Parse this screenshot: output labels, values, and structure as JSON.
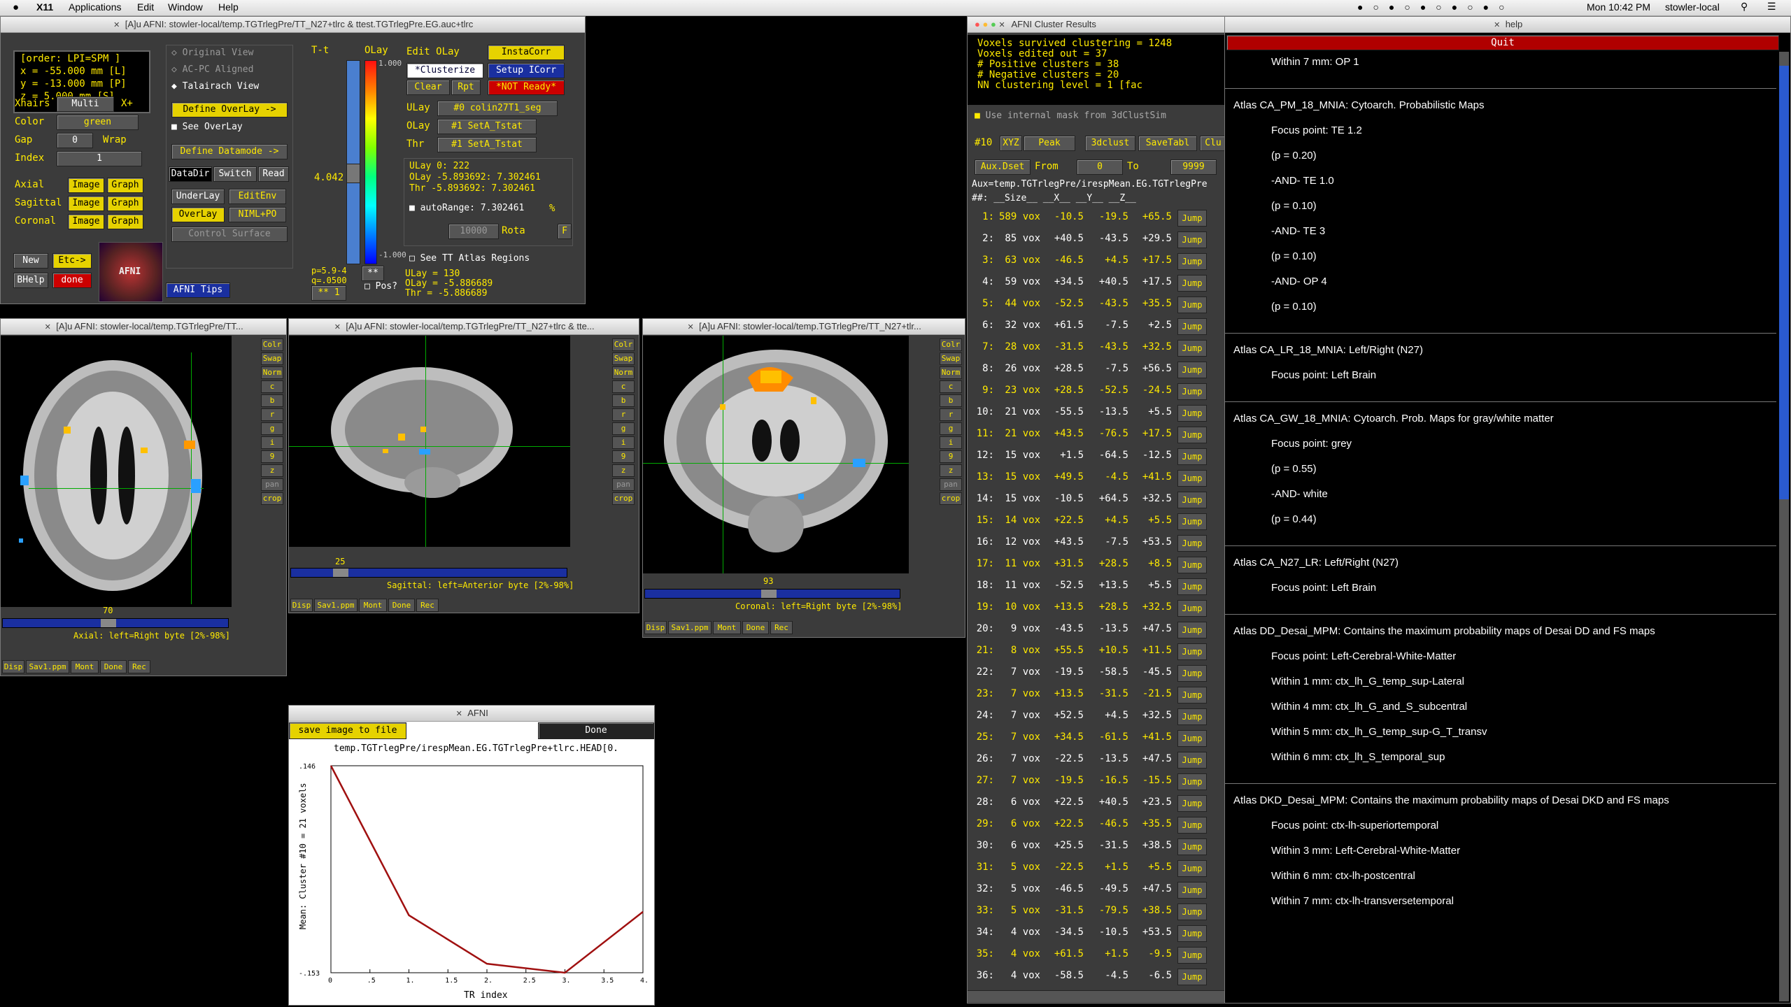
{
  "menubar": {
    "apple": "",
    "items": [
      "X11",
      "Applications",
      "Edit",
      "Window",
      "Help"
    ],
    "clock": "Mon 10:42 PM",
    "user": "stowler-local"
  },
  "main": {
    "title": "[A]u AFNI: stowler-local/temp.TGTrlegPre/TT_N27+tlrc & ttest.TGTrlegPre.EG.auc+tlrc",
    "coords": [
      "[order: LPI=SPM  ]",
      "x = -55.000 mm [L]",
      "y = -13.000 mm [P]",
      "z =   5.000 mm [S]"
    ],
    "xhairs_label": "Xhairs",
    "xhairs_value": "Multi",
    "xplus": "X+",
    "color_label": "Color",
    "color_value": "green",
    "gap_label": "Gap",
    "gap_value": "0",
    "wrap": "Wrap",
    "index_label": "Index",
    "index_value": "1",
    "views": [
      {
        "label": "Axial",
        "image": "Image",
        "graph": "Graph"
      },
      {
        "label": "Sagittal",
        "image": "Image",
        "graph": "Graph"
      },
      {
        "label": "Coronal",
        "image": "Image",
        "graph": "Graph"
      }
    ],
    "new_btn": "New",
    "etc_btn": "Etc->",
    "bhelp_btn": "BHelp",
    "done_btn": "done",
    "logo_text": "AFNI",
    "original_view": "Original View",
    "acpc_view": "AC-PC Aligned",
    "talairach_view": "Talairach View",
    "define_overlay": "Define OverLay ->",
    "see_overlay": "See OverLay",
    "define_datamode": "Define Datamode ->",
    "datadir": "DataDir",
    "switch_btn": "Switch",
    "read_btn": "Read",
    "underlay_btn": "UnderLay",
    "editenv_btn": "EditEnv",
    "overlay_btn": "OverLay",
    "nimlpo_btn": "NIML+PO",
    "control_surface": "Control Surface",
    "afni_tips": "AFNI Tips",
    "tt_label": "T-t",
    "olay_label": "OLay",
    "cbar_top": "1.000",
    "cbar_bottom": "-1.000",
    "cbar_value": "4.042",
    "edit_olay": "Edit OLay",
    "instacorr": "InstaCorr",
    "clusterize": "*Clusterize",
    "setup_icorr": "Setup ICorr",
    "clear_btn": "Clear",
    "rpt_btn": "Rpt",
    "not_ready": "*NOT Ready*",
    "ulay_label": "ULay",
    "ulay_value": "#0 colin27T1_seg",
    "olay_sel_label": "OLay",
    "olay_sel_value": "#1 SetA_Tstat",
    "thr_label": "Thr",
    "thr_value": "#1 SetA_Tstat",
    "ulay_info": "ULay        0:     222",
    "olay_info": "OLay -5.893692: 7.302461",
    "thr_info": "Thr  -5.893692: 7.302461",
    "autorange": "autoRange: 7.302461",
    "pct": "%",
    "num_field": "10000",
    "rota": "Rota",
    "fbtn": "F",
    "p_label": "p=5.9-4",
    "q_label": "q=.0500",
    "stars": "**",
    "pos_label": "Pos?",
    "see_tt": "See TT Atlas Regions",
    "pt_ulay": "ULay = 130",
    "pt_olay": "OLay = -5.886689",
    "pt_thr": "Thr  = -5.886689",
    "bottom_stars": "**",
    "bottom_num": "1"
  },
  "axial": {
    "title": "[A]u AFNI: stowler-local/temp.TGTrlegPre/TT...",
    "slice": "70",
    "caption": "Axial: left=Right byte [2%-98%]",
    "side": [
      "Colr",
      "Swap",
      "Norm",
      "c",
      "b",
      "r",
      "g",
      "i",
      "9",
      "z",
      "pan",
      "crop"
    ],
    "bottom": [
      "Disp",
      "Sav1.ppm",
      "Mont",
      "Done",
      "Rec"
    ]
  },
  "sagittal": {
    "title": "[A]u AFNI: stowler-local/temp.TGTrlegPre/TT_N27+tlrc & tte...",
    "slice": "25",
    "caption": "Sagittal: left=Anterior byte [2%-98%]",
    "side": [
      "Colr",
      "Swap",
      "Norm",
      "c",
      "b",
      "r",
      "g",
      "i",
      "9",
      "z",
      "pan",
      "crop"
    ],
    "bottom": [
      "Disp",
      "Sav1.ppm",
      "Mont",
      "Done",
      "Rec"
    ]
  },
  "coronal": {
    "title": "[A]u AFNI: stowler-local/temp.TGTrlegPre/TT_N27+tlr...",
    "slice": "93",
    "caption": "Coronal: left=Right byte [2%-98%]",
    "side": [
      "Colr",
      "Swap",
      "Norm",
      "c",
      "b",
      "r",
      "g",
      "i",
      "9",
      "z",
      "pan",
      "crop"
    ],
    "bottom": [
      "Disp",
      "Sav1.ppm",
      "Mont",
      "Done",
      "Rec"
    ]
  },
  "plot": {
    "title": "AFNI",
    "save_btn": "save image to file",
    "done_btn": "Done",
    "file_label": "temp.TGTrlegPre/irespMean.EG.TGTrlegPre+tlrc.HEAD[0.",
    "ylabel": "Mean: Cluster #10 = 21 voxels",
    "xlabel": "TR index",
    "ytick_top": ".146",
    "ytick_bottom": "-.153",
    "xticks": [
      "0",
      ".5",
      "1.",
      "1.5",
      "2.",
      "2.5",
      "3.",
      "3.5",
      "4."
    ]
  },
  "chart_data": {
    "type": "line",
    "x": [
      0,
      1,
      2,
      3,
      4
    ],
    "y": [
      0.146,
      -0.07,
      -0.14,
      -0.153,
      -0.065
    ],
    "xlim": [
      0,
      4
    ],
    "ylim": [
      -0.153,
      0.146
    ],
    "xlabel": "TR index",
    "ylabel": "Mean: Cluster #10 = 21 voxels",
    "color": "#a01010"
  },
  "cluster": {
    "title": "AFNI Cluster Results",
    "summary": [
      "Voxels survived clustering =   1248",
      "Voxels edited out          =     37",
      "# Positive clusters        =     38",
      "# Negative clusters        =     20",
      "NN clustering level        =      1 [fac"
    ],
    "use_mask": "Use internal mask from 3dClustSim",
    "num": "#10",
    "xyz": "XYZ",
    "peak": "Peak",
    "clust3d": "3dclust",
    "savetabl": "SaveTabl",
    "clu": "Clu",
    "auxdset": "Aux.Dset",
    "from_label": "From",
    "from_value": "0",
    "to_label": "To",
    "to_value": "9999",
    "auxpath": "Aux=temp.TGTrlegPre/irespMean.EG.TGTrlegPre",
    "header": "##: __Size__  __X__  __Y__  __Z__",
    "jump": "Jump",
    "rows": [
      {
        "n": "1:",
        "size": "589 vox",
        "x": "-10.5",
        "y": "-19.5",
        "z": "+65.5",
        "pos": true
      },
      {
        "n": "2:",
        "size": "85 vox",
        "x": "+40.5",
        "y": "-43.5",
        "z": "+29.5",
        "pos": false
      },
      {
        "n": "3:",
        "size": "63 vox",
        "x": "-46.5",
        "y": "+4.5",
        "z": "+17.5",
        "pos": true
      },
      {
        "n": "4:",
        "size": "59 vox",
        "x": "+34.5",
        "y": "+40.5",
        "z": "+17.5",
        "pos": false
      },
      {
        "n": "5:",
        "size": "44 vox",
        "x": "-52.5",
        "y": "-43.5",
        "z": "+35.5",
        "pos": true
      },
      {
        "n": "6:",
        "size": "32 vox",
        "x": "+61.5",
        "y": "-7.5",
        "z": "+2.5",
        "pos": false
      },
      {
        "n": "7:",
        "size": "28 vox",
        "x": "-31.5",
        "y": "-43.5",
        "z": "+32.5",
        "pos": true
      },
      {
        "n": "8:",
        "size": "26 vox",
        "x": "+28.5",
        "y": "-7.5",
        "z": "+56.5",
        "pos": false
      },
      {
        "n": "9:",
        "size": "23 vox",
        "x": "+28.5",
        "y": "-52.5",
        "z": "-24.5",
        "pos": true
      },
      {
        "n": "10:",
        "size": "21 vox",
        "x": "-55.5",
        "y": "-13.5",
        "z": "+5.5",
        "pos": false
      },
      {
        "n": "11:",
        "size": "21 vox",
        "x": "+43.5",
        "y": "-76.5",
        "z": "+17.5",
        "pos": true
      },
      {
        "n": "12:",
        "size": "15 vox",
        "x": "+1.5",
        "y": "-64.5",
        "z": "-12.5",
        "pos": false
      },
      {
        "n": "13:",
        "size": "15 vox",
        "x": "+49.5",
        "y": "-4.5",
        "z": "+41.5",
        "pos": true
      },
      {
        "n": "14:",
        "size": "15 vox",
        "x": "-10.5",
        "y": "+64.5",
        "z": "+32.5",
        "pos": false
      },
      {
        "n": "15:",
        "size": "14 vox",
        "x": "+22.5",
        "y": "+4.5",
        "z": "+5.5",
        "pos": true
      },
      {
        "n": "16:",
        "size": "12 vox",
        "x": "+43.5",
        "y": "-7.5",
        "z": "+53.5",
        "pos": false
      },
      {
        "n": "17:",
        "size": "11 vox",
        "x": "+31.5",
        "y": "+28.5",
        "z": "+8.5",
        "pos": true
      },
      {
        "n": "18:",
        "size": "11 vox",
        "x": "-52.5",
        "y": "+13.5",
        "z": "+5.5",
        "pos": false
      },
      {
        "n": "19:",
        "size": "10 vox",
        "x": "+13.5",
        "y": "+28.5",
        "z": "+32.5",
        "pos": true
      },
      {
        "n": "20:",
        "size": "9 vox",
        "x": "-43.5",
        "y": "-13.5",
        "z": "+47.5",
        "pos": false
      },
      {
        "n": "21:",
        "size": "8 vox",
        "x": "+55.5",
        "y": "+10.5",
        "z": "+11.5",
        "pos": true
      },
      {
        "n": "22:",
        "size": "7 vox",
        "x": "-19.5",
        "y": "-58.5",
        "z": "-45.5",
        "pos": false
      },
      {
        "n": "23:",
        "size": "7 vox",
        "x": "+13.5",
        "y": "-31.5",
        "z": "-21.5",
        "pos": true
      },
      {
        "n": "24:",
        "size": "7 vox",
        "x": "+52.5",
        "y": "+4.5",
        "z": "+32.5",
        "pos": false
      },
      {
        "n": "25:",
        "size": "7 vox",
        "x": "+34.5",
        "y": "-61.5",
        "z": "+41.5",
        "pos": true
      },
      {
        "n": "26:",
        "size": "7 vox",
        "x": "-22.5",
        "y": "-13.5",
        "z": "+47.5",
        "pos": false
      },
      {
        "n": "27:",
        "size": "7 vox",
        "x": "-19.5",
        "y": "-16.5",
        "z": "-15.5",
        "pos": true
      },
      {
        "n": "28:",
        "size": "6 vox",
        "x": "+22.5",
        "y": "+40.5",
        "z": "+23.5",
        "pos": false
      },
      {
        "n": "29:",
        "size": "6 vox",
        "x": "+22.5",
        "y": "-46.5",
        "z": "+35.5",
        "pos": true
      },
      {
        "n": "30:",
        "size": "6 vox",
        "x": "+25.5",
        "y": "-31.5",
        "z": "+38.5",
        "pos": false
      },
      {
        "n": "31:",
        "size": "5 vox",
        "x": "-22.5",
        "y": "+1.5",
        "z": "+5.5",
        "pos": true
      },
      {
        "n": "32:",
        "size": "5 vox",
        "x": "-46.5",
        "y": "-49.5",
        "z": "+47.5",
        "pos": false
      },
      {
        "n": "33:",
        "size": "5 vox",
        "x": "-31.5",
        "y": "-79.5",
        "z": "+38.5",
        "pos": true
      },
      {
        "n": "34:",
        "size": "4 vox",
        "x": "-34.5",
        "y": "-10.5",
        "z": "+53.5",
        "pos": false
      },
      {
        "n": "35:",
        "size": "4 vox",
        "x": "+61.5",
        "y": "+1.5",
        "z": "-9.5",
        "pos": true
      },
      {
        "n": "36:",
        "size": "4 vox",
        "x": "-58.5",
        "y": "-4.5",
        "z": "-6.5",
        "pos": false
      }
    ]
  },
  "help": {
    "title": "help",
    "quit": "Quit",
    "sections": [
      {
        "head": "",
        "lines": [
          "Within 7 mm: OP 1"
        ]
      },
      {
        "head": "Atlas CA_PM_18_MNIA: Cytoarch. Probabilistic Maps",
        "lines": [
          "Focus point: TE 1.2",
          "(p = 0.20)",
          "-AND- TE 1.0",
          "(p = 0.10)",
          "-AND- TE 3",
          "(p = 0.10)",
          "-AND- OP 4",
          "(p = 0.10)"
        ]
      },
      {
        "head": "Atlas CA_LR_18_MNIA: Left/Right (N27)",
        "lines": [
          "Focus point: Left Brain"
        ]
      },
      {
        "head": "Atlas CA_GW_18_MNIA: Cytoarch. Prob. Maps for gray/white matter",
        "lines": [
          "Focus point: grey",
          "(p = 0.55)",
          "-AND- white",
          "(p = 0.44)"
        ]
      },
      {
        "head": "Atlas CA_N27_LR: Left/Right (N27)",
        "lines": [
          "Focus point: Left Brain"
        ]
      },
      {
        "head": "Atlas DD_Desai_MPM: Contains the maximum probability maps of Desai DD and FS maps",
        "lines": [
          "Focus point: Left-Cerebral-White-Matter",
          "Within 1 mm: ctx_lh_G_temp_sup-Lateral",
          "Within 4 mm: ctx_lh_G_and_S_subcentral",
          "Within 5 mm: ctx_lh_G_temp_sup-G_T_transv",
          "Within 6 mm: ctx_lh_S_temporal_sup"
        ]
      },
      {
        "head": "Atlas DKD_Desai_MPM: Contains the maximum probability maps of Desai DKD and FS maps",
        "lines": [
          "Focus point: ctx-lh-superiortemporal",
          "Within 3 mm: Left-Cerebral-White-Matter",
          "Within 6 mm: ctx-lh-postcentral",
          "Within 7 mm: ctx-lh-transversetemporal"
        ]
      }
    ]
  }
}
